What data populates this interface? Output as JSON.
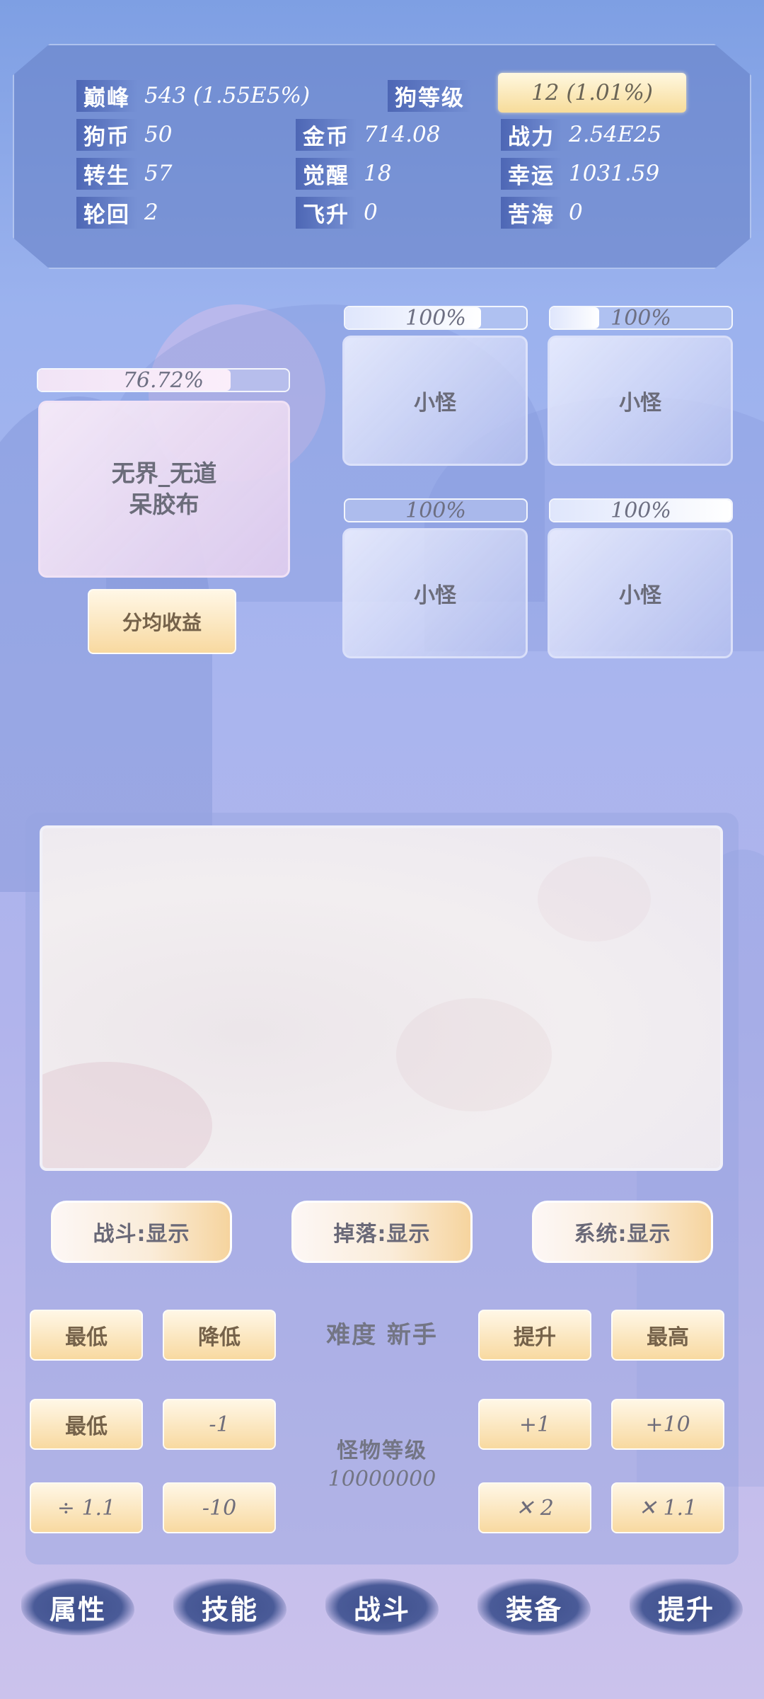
{
  "stats": {
    "peak_label": "巅峰",
    "peak_value": "543 (1.55E5%)",
    "dog_level_label": "狗等级",
    "dog_level_value": "12 (1.01%)",
    "dog_coin_label": "狗币",
    "dog_coin_value": "50",
    "gold_label": "金币",
    "gold_value": "714.08",
    "power_label": "战力",
    "power_value": "2.54E25",
    "rebirth_label": "转生",
    "rebirth_value": "57",
    "awaken_label": "觉醒",
    "awaken_value": "18",
    "luck_label": "幸运",
    "luck_value": "1031.59",
    "cycle_label": "轮回",
    "cycle_value": "2",
    "ascend_label": "飞升",
    "ascend_value": "0",
    "sea_label": "苦海",
    "sea_value": "0"
  },
  "battle": {
    "boss": {
      "hp_text": "76.72%",
      "hp": 0.7672,
      "name_line1": "无界_无道",
      "name_line2": "呆胶布"
    },
    "mobs": [
      {
        "hp_text": "100%",
        "hp": 0.75,
        "name": "小怪"
      },
      {
        "hp_text": "100%",
        "hp": 0.27,
        "name": "小怪"
      },
      {
        "hp_text": "100%",
        "hp": 0.0,
        "name": "小怪"
      },
      {
        "hp_text": "100%",
        "hp": 1.0,
        "name": "小怪"
      }
    ],
    "share_button": "分均收益"
  },
  "filters": {
    "battle": "战斗:显示",
    "drop": "掉落:显示",
    "system": "系统:显示"
  },
  "difficulty": {
    "lowest": "最低",
    "lower": "降低",
    "label": "难度 新手",
    "raise": "提升",
    "highest": "最高"
  },
  "monster_level": {
    "lowest": "最低",
    "minus1": "-1",
    "plus1": "+1",
    "plus10": "+10",
    "label": "怪物等级",
    "value": "10000000",
    "div": "÷ 1.1",
    "minus10": "-10",
    "times2": "✕ 2",
    "times11": "✕ 1.1"
  },
  "nav": [
    "属性",
    "技能",
    "战斗",
    "装备",
    "提升"
  ]
}
